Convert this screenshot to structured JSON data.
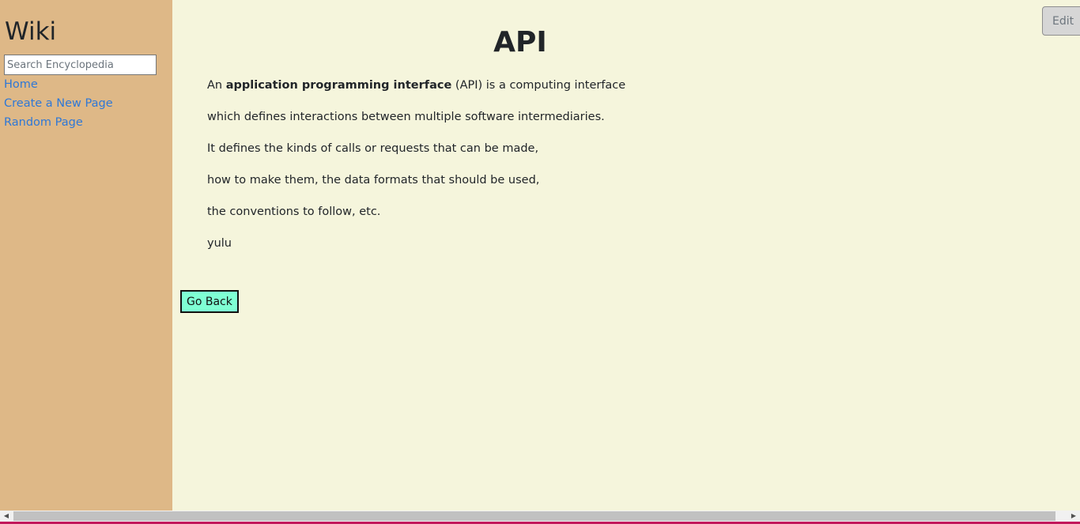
{
  "sidebar": {
    "title": "Wiki",
    "search": {
      "placeholder": "Search Encyclopedia",
      "value": ""
    },
    "links": [
      {
        "label": "Home"
      },
      {
        "label": "Create a New Page"
      },
      {
        "label": "Random Page"
      }
    ]
  },
  "page": {
    "title": "API",
    "intro_prefix": "An",
    "intro_bold": "application programming interface",
    "intro_suffix": "(API) is a computing interface",
    "lines": [
      "which defines interactions between multiple software intermediaries.",
      "It defines the kinds of calls or requests that can be made,",
      "how to make them, the data formats that should be used,",
      "the conventions to follow, etc.",
      "yulu"
    ],
    "go_back_label": "Go Back"
  },
  "toolbar": {
    "edit_label": "Edit"
  },
  "scrollbar": {
    "left_arrow_icon": "scroll-left-arrow-icon",
    "right_arrow_icon": "scroll-right-arrow-icon"
  },
  "colors": {
    "sidebar_bg": "#deb887",
    "main_bg": "#f5f5dc",
    "link": "#2f78d6",
    "go_back_bg": "#7fffd4"
  }
}
